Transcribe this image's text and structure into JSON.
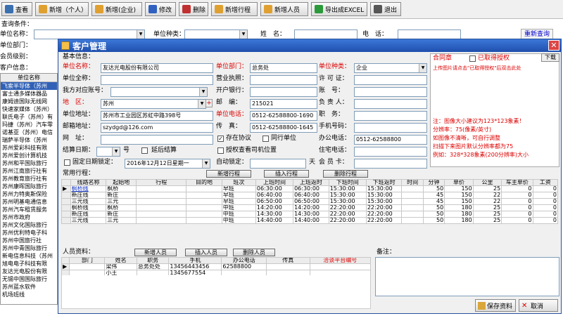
{
  "toolbar": [
    {
      "label": "查看",
      "color": "#3a6fb0"
    },
    {
      "label": "新增（个人）",
      "color": "#e0a030"
    },
    {
      "label": "新增(企业)",
      "color": "#e0a030"
    },
    {
      "label": "修改",
      "color": "#3060c0"
    },
    {
      "label": "删除",
      "color": "#c03030"
    },
    {
      "label": "新增行程",
      "color": "#e0a030"
    },
    {
      "label": "新增人员",
      "color": "#e0a030"
    },
    {
      "label": "导出成EXCEL",
      "color": "#2a9a3a"
    },
    {
      "label": "退出",
      "color": "#555555"
    }
  ],
  "query": {
    "title": "查询条件：",
    "unit_name": "单位名称：",
    "unit_type": "单位种类：",
    "name": "姓　名：",
    "phone": "电　话：",
    "reset": "重新查询",
    "dept": "单位部门：",
    "member": "会员级别："
  },
  "bg_list": {
    "title": "客户信息：",
    "header": "单位名称",
    "items": [
      "飞索半导体（苏州",
      "富士通多媒体器品",
      "康姆迪国际无线网",
      "快速家媒体（苏州）",
      "联氏电子（苏州）有",
      "玛捷（苏州）汽车零",
      "诺基亚（苏州）电信",
      "瑞萨半导体（苏州",
      "苏州爱彩科技有限",
      "苏州爱创计算机技",
      "苏州和平国际旅行",
      "苏州江南旅行社有",
      "苏州教育旅行社有",
      "苏州康晖国际旅行",
      "苏州力特奥斯保险",
      "苏州明基电通信息",
      "苏州汽车租赁服务",
      "苏州市政府",
      "苏州文化国际旅行",
      "苏州优利特电子科",
      "苏州中国旅行社",
      "苏州中青国际旅行",
      "新电信息科技（苏州",
      "旭电电子科技有限",
      "友达光电股份有限",
      "无锡中国国际旅行",
      "苏州蓝水软件",
      "机场班线"
    ]
  },
  "dialog": {
    "title": "客户管理",
    "section": "基本信息：",
    "unit_name_lbl": "单位名称：",
    "unit_name": "友达光电股份有限公司",
    "dept_lbl": "单位部门：",
    "dept": "总务处",
    "type_lbl": "单位种类：",
    "type": "企业",
    "full_lbl": "单位全称：",
    "license_lbl": "营业执照：",
    "permit_lbl": "许 可 证：",
    "account_lbl": "我方对应账号：",
    "bank_lbl": "开户银行：",
    "acct_lbl": "账　号：",
    "region_lbl": "地　区：",
    "region": "苏州",
    "zip_lbl": "邮　编：",
    "zip": "215021",
    "owner_lbl": "负 责 人：",
    "addr_lbl": "单位地址：",
    "addr": "苏州市工业园区苏虹中路398号",
    "tel_lbl": "单位电话：",
    "tel": "0512-62588800-1690",
    "title_lbl": "职　务：",
    "email_lbl": "邮箱地址：",
    "email": "szydgd@126.com",
    "fax_lbl": "传　真：",
    "fax": "0512-62588800-1645",
    "mobile_lbl": "手机号码：",
    "web_lbl": "网　址：",
    "agreement": "存在协议",
    "peer": "同行单位",
    "office_lbl": "办公电话：",
    "office": "0512-62588800",
    "settle_lbl": "结算日期：",
    "settle_unit": "号",
    "delay": "延后结算",
    "auth_driver": "授权查看司机位置",
    "home_lbl": "住宅电话：",
    "fixed_lbl": "固定日期锁定：",
    "fixed_date": "2016年12月12日星期一",
    "auto_lbl": "自动锁定：",
    "day_unit": "天",
    "card_lbl": "会 员 卡：",
    "contract_lbl": "合同章",
    "auth_lbl": "已取得授权",
    "download": "下载",
    "upload_hint": "上传图片请点击\"已取得授权\"后双击此处",
    "notes": [
      "注：图像大小建议为123*123象素！",
      "分辨率：75(像素/英寸)",
      "如图像不清晰，可自行调整",
      "扫描下来图片默认分辨率都为75",
      "例如：328*328象素(200分辨率)大小"
    ],
    "route_title": "常用行程：",
    "route_btns": [
      "新增行程",
      "插入行程",
      "删除行程"
    ],
    "route_cols": [
      "线路名称",
      "起始地",
      "行程",
      "目的地",
      "班次",
      "上班时间",
      "上班返时",
      "下班时间",
      "下班返时",
      "时间",
      "分钟",
      "单价",
      "公里",
      "车主单价",
      "工资"
    ],
    "routes": [
      [
        "枫桥线",
        "枫桥",
        "",
        "",
        "早班",
        "06:30:00",
        "06:30:00",
        "15:30:00",
        "15:30:00",
        "",
        "50",
        "150",
        "25",
        "0",
        "0"
      ],
      [
        "新庄线",
        "新庄",
        "",
        "",
        "早班",
        "06:40:00",
        "06:40:00",
        "15:30:00",
        "15:30:00",
        "",
        "45",
        "150",
        "22",
        "0",
        "0"
      ],
      [
        "三元线",
        "三元",
        "",
        "",
        "早班",
        "06:50:00",
        "06:50:00",
        "15:30:00",
        "15:30:00",
        "",
        "45",
        "150",
        "22",
        "0",
        "0"
      ],
      [
        "枫桥线",
        "枫桥",
        "",
        "",
        "中班",
        "14:20:00",
        "14:20:00",
        "22:20:00",
        "22:20:00",
        "",
        "50",
        "180",
        "25",
        "0",
        "0"
      ],
      [
        "新庄线",
        "新庄",
        "",
        "",
        "中班",
        "14:30:00",
        "14:30:00",
        "22:20:00",
        "22:20:00",
        "",
        "50",
        "180",
        "25",
        "0",
        "0"
      ],
      [
        "三元线",
        "三元",
        "",
        "",
        "中班",
        "14:40:00",
        "14:40:00",
        "22:20:00",
        "22:20:00",
        "",
        "50",
        "180",
        "25",
        "0",
        "0"
      ]
    ],
    "staff_title": "人员资料：",
    "staff_btns": [
      "新增人员",
      "插入人员",
      "删除人员"
    ],
    "staff_cols": [
      "部门",
      "姓名",
      "职务",
      "手机",
      "办公电话",
      "传真",
      "洽谈平台编号"
    ],
    "staff": [
      [
        "",
        "梁伟",
        "总务处处",
        "13456443456",
        "62588800",
        "",
        ""
      ],
      [
        "",
        "小王",
        "",
        "1345677554",
        "",
        "",
        ""
      ]
    ],
    "remark_lbl": "备注：",
    "save": "保存资料",
    "cancel": "取消"
  }
}
